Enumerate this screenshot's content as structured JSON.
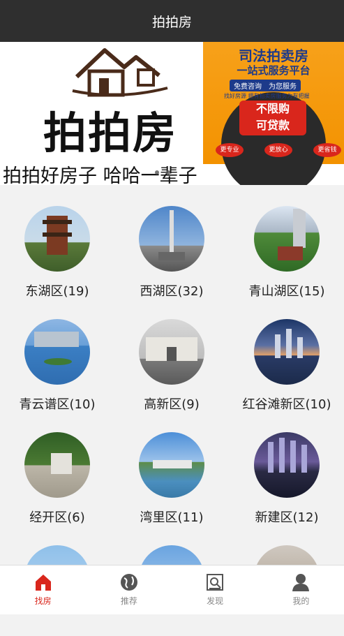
{
  "app": {
    "title": "拍拍房"
  },
  "banner": {
    "logo_text": "拍拍房",
    "slogan": "拍拍好房子 哈哈一辈子",
    "ad": {
      "title": "司法拍卖房",
      "subtitle": "一站式服务平台",
      "tag": "免费咨询　为您服务",
      "small": "找好房源 拥有拍卖房服务为有把握",
      "highlight1": "不限购",
      "highlight2": "可贷款",
      "buttons": [
        "更专业",
        "更放心",
        "更省钱"
      ]
    }
  },
  "districts": [
    {
      "label": "东湖区(19)"
    },
    {
      "label": "西湖区(32)"
    },
    {
      "label": "青山湖区(15)"
    },
    {
      "label": "青云谱区(10)"
    },
    {
      "label": "高新区(9)"
    },
    {
      "label": "红谷滩新区(10)"
    },
    {
      "label": "经开区(6)"
    },
    {
      "label": "湾里区(11)"
    },
    {
      "label": "新建区(12)"
    }
  ],
  "tabs": [
    {
      "label": "找房",
      "icon": "home-icon",
      "active": true
    },
    {
      "label": "推荐",
      "icon": "globe-icon",
      "active": false
    },
    {
      "label": "发现",
      "icon": "discover-icon",
      "active": false
    },
    {
      "label": "我的",
      "icon": "user-icon",
      "active": false
    }
  ],
  "colors": {
    "titlebar": "#2f2f2f",
    "accent": "#d9261c",
    "ad_orange": "#f39200"
  }
}
